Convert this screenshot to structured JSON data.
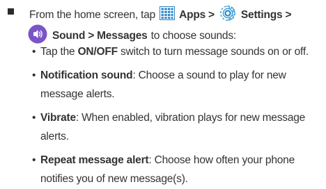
{
  "intro": {
    "lead": "From the home screen, tap",
    "apps_label": "Apps",
    "sep1": ">",
    "settings_label": "Settings",
    "sep2": ">",
    "sound_label": "Sound",
    "sep3": ">",
    "messages_label": "Messages",
    "tail": "to choose sounds:"
  },
  "icons": {
    "apps": "apps-grid-icon",
    "settings": "settings-gear-icon",
    "sound": "sound-speaker-icon"
  },
  "colors": {
    "apps_icon": "#2e86c8",
    "settings_icon": "#2f95d0",
    "sound_icon": "#7b55c7"
  },
  "items": [
    {
      "bullet": "•",
      "pre": "Tap the",
      "bold": "ON/OFF",
      "post": "switch to turn message sounds on or off."
    },
    {
      "bullet": "•",
      "bold": "Notification sound",
      "line1": ": Choose a sound to play for new",
      "line2": "message alerts."
    },
    {
      "bullet": "•",
      "bold": "Vibrate",
      "line1": ": When enabled, vibration plays for new message",
      "line2": "alerts."
    },
    {
      "bullet": "•",
      "bold": "Repeat message alert",
      "line1": ": Choose how often your phone",
      "line2": "notifies you of new message(s)."
    }
  ]
}
